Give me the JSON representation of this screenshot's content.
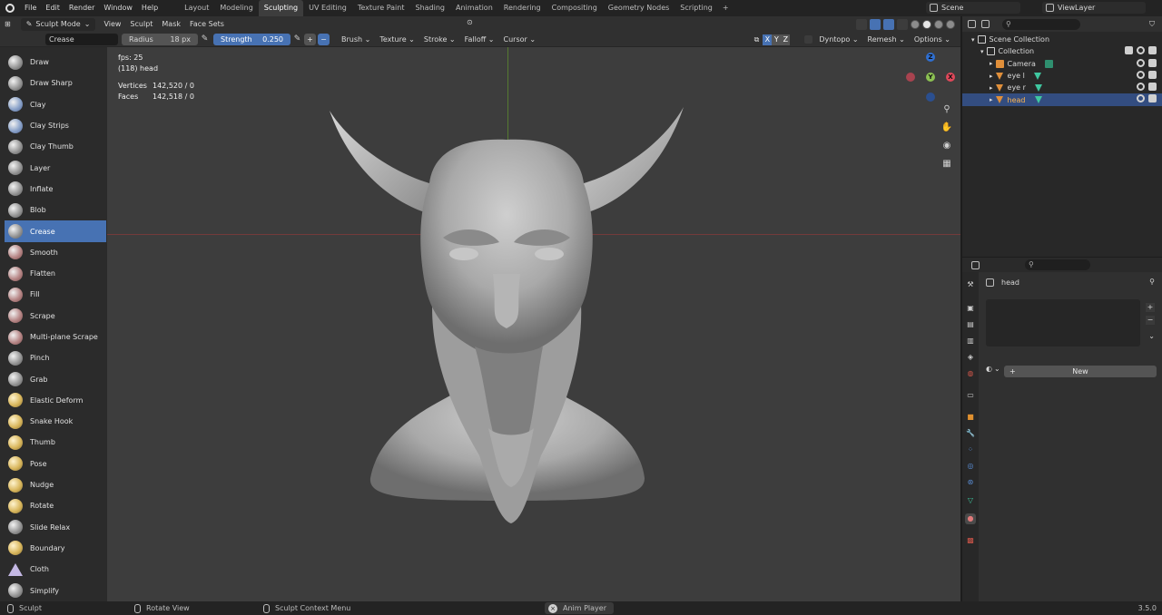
{
  "menu": {
    "items": [
      "File",
      "Edit",
      "Render",
      "Window",
      "Help"
    ]
  },
  "workspaces": {
    "tabs": [
      "Layout",
      "Modeling",
      "Sculpting",
      "UV Editing",
      "Texture Paint",
      "Shading",
      "Animation",
      "Rendering",
      "Compositing",
      "Geometry Nodes",
      "Scripting"
    ],
    "active": "Sculpting",
    "add": "+"
  },
  "scene": {
    "name": "Scene"
  },
  "view_layer": {
    "name": "ViewLayer"
  },
  "viewport_header": {
    "mode": "Sculpt Mode",
    "menus": [
      "View",
      "Sculpt",
      "Mask",
      "Face Sets"
    ]
  },
  "tool_settings": {
    "brush": "Crease",
    "radius_label": "Radius",
    "radius_value": "18 px",
    "strength_label": "Strength",
    "strength_value": "0.250",
    "plus": "+",
    "minus": "−",
    "dropdowns": [
      "Brush",
      "Texture",
      "Stroke",
      "Falloff",
      "Cursor"
    ],
    "axes": [
      "X",
      "Y",
      "Z"
    ],
    "right": [
      "Dyntopo",
      "Remesh",
      "Options"
    ]
  },
  "stats": {
    "fps": "fps: 25",
    "object": "(118) head",
    "vertices_label": "Vertices",
    "vertices": "142,520 / 0",
    "faces_label": "Faces",
    "faces": "142,518 / 0"
  },
  "gizmo": {
    "x": "X",
    "y": "Y",
    "z": "Z"
  },
  "tools": [
    {
      "label": "Draw",
      "color": "grey"
    },
    {
      "label": "Draw Sharp",
      "color": "grey"
    },
    {
      "label": "Clay",
      "color": "blue"
    },
    {
      "label": "Clay Strips",
      "color": "blue"
    },
    {
      "label": "Clay Thumb",
      "color": "grey"
    },
    {
      "label": "Layer",
      "color": "grey"
    },
    {
      "label": "Inflate",
      "color": "grey"
    },
    {
      "label": "Blob",
      "color": "grey"
    },
    {
      "label": "Crease",
      "color": "grey",
      "active": true
    },
    {
      "label": "Smooth",
      "color": "red"
    },
    {
      "label": "Flatten",
      "color": "red"
    },
    {
      "label": "Fill",
      "color": "red"
    },
    {
      "label": "Scrape",
      "color": "red"
    },
    {
      "label": "Multi-plane Scrape",
      "color": "red"
    },
    {
      "label": "Pinch",
      "color": "grey"
    },
    {
      "label": "Grab",
      "color": "grey"
    },
    {
      "label": "Elastic Deform",
      "color": "yellow"
    },
    {
      "label": "Snake Hook",
      "color": "yellow"
    },
    {
      "label": "Thumb",
      "color": "yellow"
    },
    {
      "label": "Pose",
      "color": "yellow"
    },
    {
      "label": "Nudge",
      "color": "yellow"
    },
    {
      "label": "Rotate",
      "color": "yellow"
    },
    {
      "label": "Slide Relax",
      "color": "grey"
    },
    {
      "label": "Boundary",
      "color": "yellow"
    },
    {
      "label": "Cloth",
      "color": "cloth"
    },
    {
      "label": "Simplify",
      "color": "grey"
    }
  ],
  "outliner": {
    "rows": [
      {
        "name": "Scene Collection",
        "indent": 1
      },
      {
        "name": "Collection",
        "indent": 2
      },
      {
        "name": "Camera",
        "indent": 3
      },
      {
        "name": "eye l",
        "indent": 3
      },
      {
        "name": "eye r",
        "indent": 3
      },
      {
        "name": "head",
        "indent": 3,
        "selected": true
      }
    ]
  },
  "properties": {
    "object_name": "head",
    "new_label": "New"
  },
  "statusbar": {
    "left": "Sculpt",
    "middle": "Rotate View",
    "context": "Sculpt Context Menu",
    "anim_player": "Anim Player",
    "version": "3.5.0"
  },
  "colors": {
    "accent": "#4772b3",
    "selected_row": "#334d80",
    "selected_text": "#ffb54d",
    "viewport_bg": "#3d3d3d"
  }
}
